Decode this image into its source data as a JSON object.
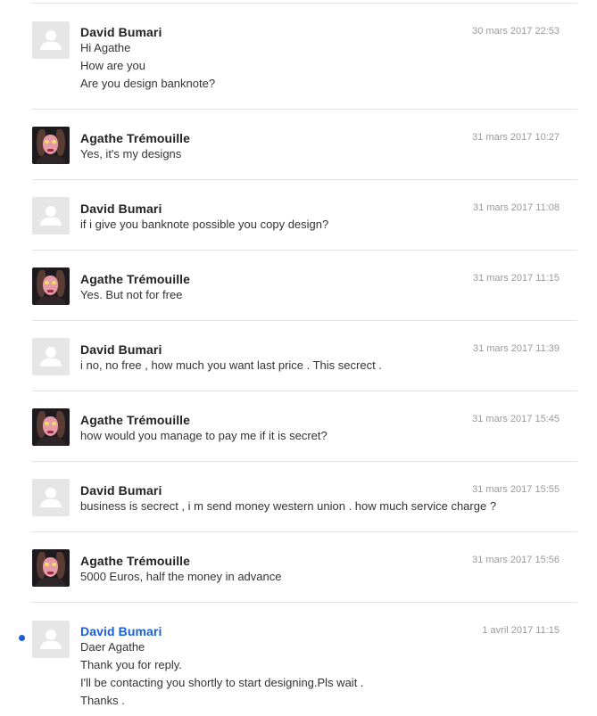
{
  "messages": [
    {
      "sender": "David Bumari",
      "timestamp": "30 mars 2017 22:53",
      "avatar": "default-user-icon",
      "unread": false,
      "lines": [
        "Hi Agathe",
        "How are you",
        "Are you design banknote?"
      ]
    },
    {
      "sender": "Agathe Trémouille",
      "timestamp": "31 mars 2017 10:27",
      "avatar": "profile-photo",
      "unread": false,
      "lines": [
        "Yes, it's my designs"
      ]
    },
    {
      "sender": "David Bumari",
      "timestamp": "31 mars 2017 11:08",
      "avatar": "default-user-icon",
      "unread": false,
      "lines": [
        "if i give you banknote possible you copy design?"
      ]
    },
    {
      "sender": "Agathe Trémouille",
      "timestamp": "31 mars 2017 11:15",
      "avatar": "profile-photo",
      "unread": false,
      "lines": [
        "Yes. But not for free"
      ]
    },
    {
      "sender": "David Bumari",
      "timestamp": "31 mars 2017 11:39",
      "avatar": "default-user-icon",
      "unread": false,
      "lines": [
        "i no, no free , how much you want last price . This secrect ."
      ]
    },
    {
      "sender": "Agathe Trémouille",
      "timestamp": "31 mars 2017 15:45",
      "avatar": "profile-photo",
      "unread": false,
      "lines": [
        "how would you manage to pay me if it is secret?"
      ]
    },
    {
      "sender": "David Bumari",
      "timestamp": "31 mars 2017 15:55",
      "avatar": "default-user-icon",
      "unread": false,
      "lines": [
        "business is secrect , i m send money western union . how much service charge ?"
      ]
    },
    {
      "sender": "Agathe Trémouille",
      "timestamp": "31 mars 2017 15:56",
      "avatar": "profile-photo",
      "unread": false,
      "lines": [
        "5000 Euros, half the money in advance"
      ]
    },
    {
      "sender": "David Bumari",
      "timestamp": "1 avril 2017 11:15",
      "avatar": "default-user-icon",
      "unread": true,
      "lines": [
        "Daer Agathe",
        "Thank you for reply.",
        "I'll be contacting you shortly to start designing.Pls wait .",
        "Thanks ."
      ]
    }
  ],
  "colors": {
    "unread_accent": "#1a5fd6",
    "divider": "#e3e3e3",
    "timestamp": "#9a9a9a"
  }
}
